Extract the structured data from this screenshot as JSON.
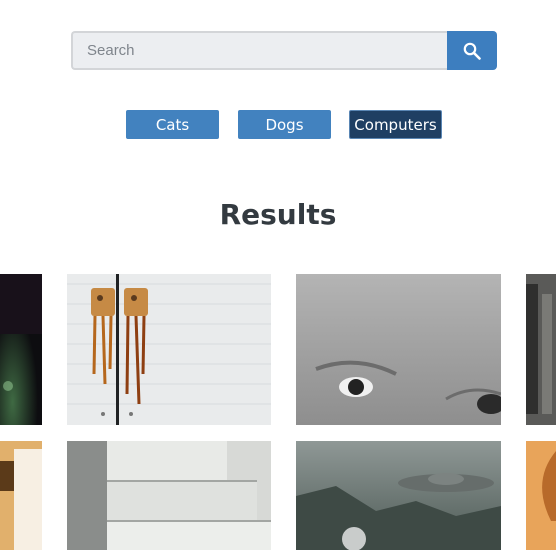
{
  "search": {
    "placeholder": "Search",
    "button_icon": "search-icon"
  },
  "categories": [
    {
      "label": "Cats",
      "active": false
    },
    {
      "label": "Dogs",
      "active": false
    },
    {
      "label": "Computers",
      "active": true
    }
  ],
  "results": {
    "title": "Results"
  },
  "colors": {
    "accent": "#4282bf",
    "active": "#1f3f63",
    "title": "#333a40"
  }
}
